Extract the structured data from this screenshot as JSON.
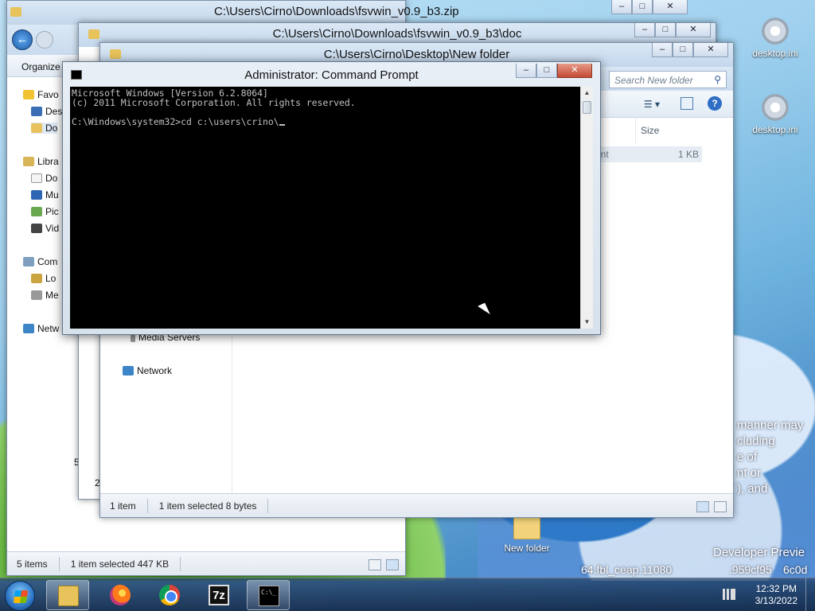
{
  "desktop": {
    "icons": [
      {
        "label": "desktop.ini"
      },
      {
        "label": "desktop.ini"
      },
      {
        "label": "New folder"
      }
    ],
    "watermark_lines": [
      "manner may",
      "cluding",
      "e of",
      "nt or",
      "), and",
      "Developer Previe",
      "64.fbl_ceap.11080",
      ".959cf95",
      "6c0d"
    ]
  },
  "windows": {
    "back": {
      "title": "C:\\Users\\Cirno\\Downloads\\fsvwin_v0.9_b3.zip",
      "status_items": "5 items",
      "status_selected": "1 item selected  447 KB",
      "nav": [
        "Organize",
        "Favo",
        "Des",
        "Do",
        "Libra",
        "Do",
        "Mu",
        "Pic",
        "Vid",
        "Com",
        "Lo",
        "Me",
        "Netw"
      ],
      "partial_count": "5"
    },
    "middle": {
      "title": "C:\\Users\\Cirno\\Downloads\\fsvwin_v0.9_b3\\doc",
      "partial_count": "2"
    },
    "front": {
      "title": "C:\\Users\\Cirno\\Desktop\\New folder",
      "search_placeholder": "Search New folder",
      "column_size": "Size",
      "row_type_partial": "ent",
      "row_size": "1 KB",
      "nav": [
        "Media Servers",
        "Network"
      ],
      "status_items": "1 item",
      "status_selected": "1 item selected  8 bytes"
    }
  },
  "cmd": {
    "title": "Administrator: Command Prompt",
    "lines": [
      "Microsoft Windows [Version 6.2.8064]",
      "(c) 2011 Microsoft Corporation. All rights reserved.",
      "",
      "C:\\Windows\\system32>cd c:\\users\\crino\\"
    ]
  },
  "taskbar": {
    "buttons": [
      {
        "name": "Windows Explorer"
      },
      {
        "name": "Firefox"
      },
      {
        "name": "Google Chrome"
      },
      {
        "name": "7-Zip",
        "label": "7z"
      },
      {
        "name": "Command Prompt",
        "label": "C:\\_"
      }
    ],
    "time": "12:32 PM",
    "date": "3/13/2022"
  }
}
